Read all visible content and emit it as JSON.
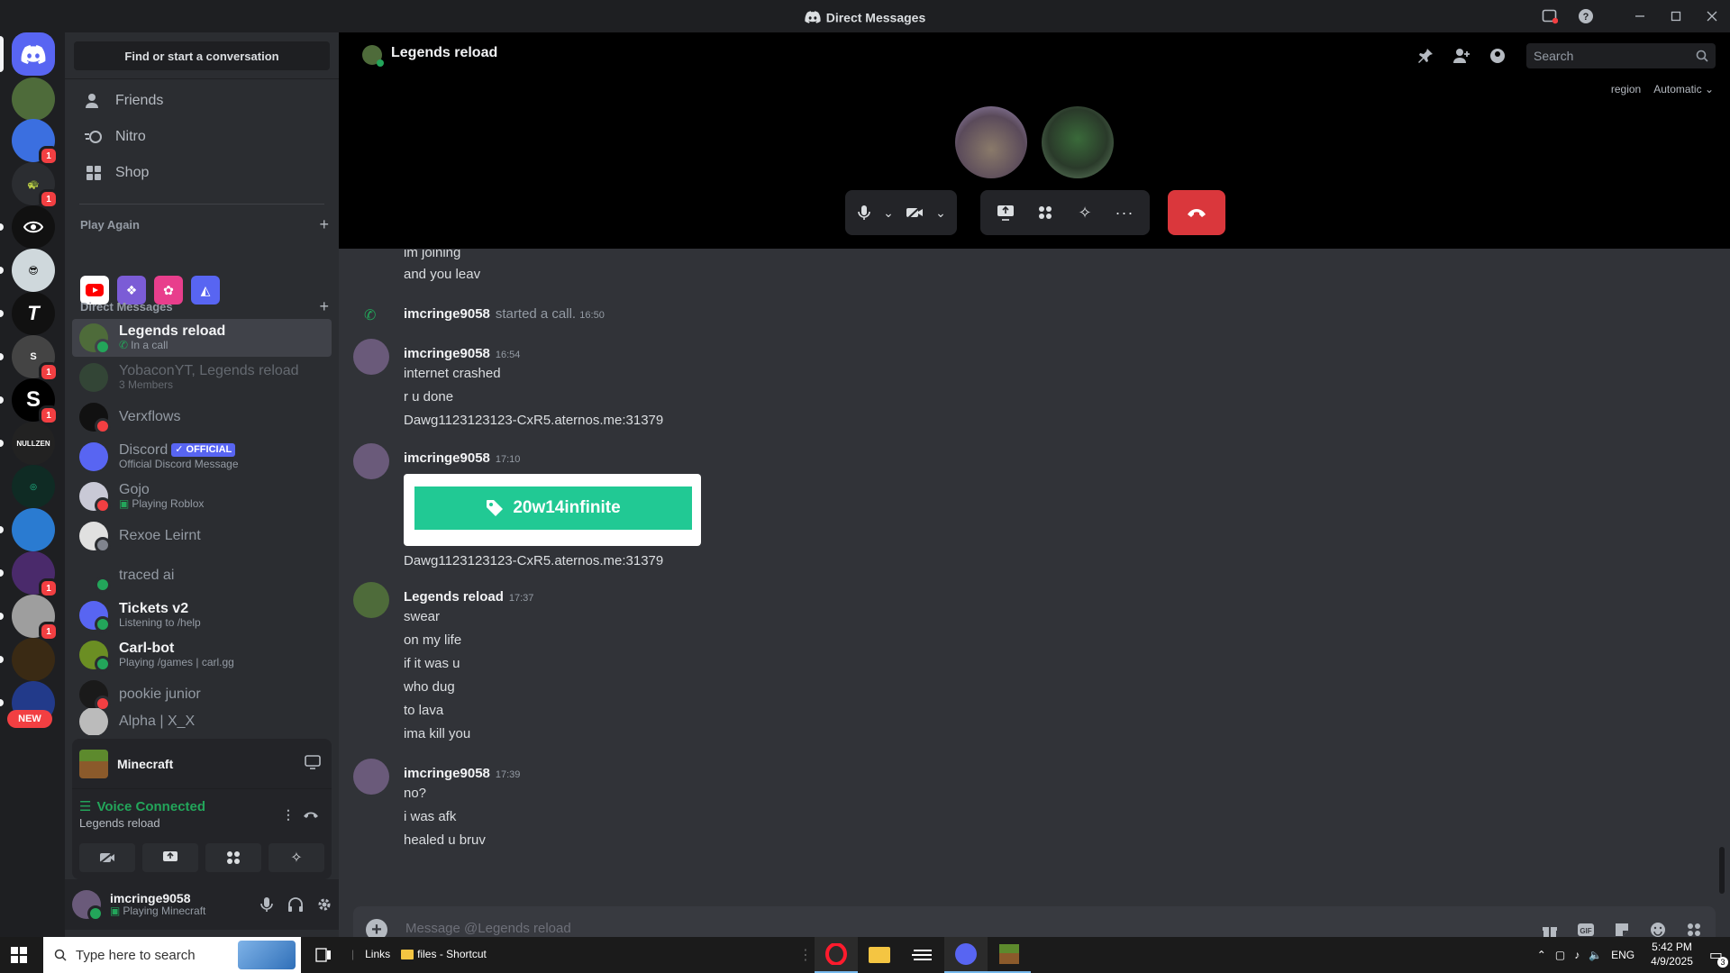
{
  "window": {
    "title": "Direct Messages"
  },
  "rail": {
    "new_label": "NEW",
    "badges": [
      "1",
      "1",
      "1",
      "1",
      "1",
      "1"
    ]
  },
  "sidebar": {
    "find_label": "Find or start a conversation",
    "nav": [
      {
        "label": "Friends",
        "icon": "friends-icon"
      },
      {
        "label": "Nitro",
        "icon": "nitro-icon"
      },
      {
        "label": "Shop",
        "icon": "shop-icon"
      }
    ],
    "play_again": "Play Again",
    "dm_header": "Direct Messages",
    "dms": [
      {
        "name": "Legends reload",
        "sub": "In a call",
        "status": "online",
        "active": true
      },
      {
        "name": "YobaconYT, Legends reload",
        "sub": "3 Members"
      },
      {
        "name": "Verxflows",
        "sub": "",
        "status": "dnd"
      },
      {
        "name": "Discord",
        "badge": "OFFICIAL",
        "sub": "Official Discord Message"
      },
      {
        "name": "Gojo",
        "sub": "Playing Roblox",
        "status": "dnd"
      },
      {
        "name": "Rexoe Leirnt",
        "sub": "",
        "status": "offline"
      },
      {
        "name": "traced ai",
        "sub": "",
        "status": "online"
      },
      {
        "name": "Tickets v2",
        "sub": "Listening to /help",
        "status": "online"
      },
      {
        "name": "Carl-bot",
        "sub": "Playing /games | carl.gg",
        "status": "online"
      },
      {
        "name": "pookie junior",
        "sub": "",
        "status": "dnd"
      },
      {
        "name": "Alpha | X_X",
        "sub": ""
      }
    ]
  },
  "activity": {
    "game": "Minecraft"
  },
  "voice": {
    "status": "Voice Connected",
    "channel": "Legends reload"
  },
  "user": {
    "name": "imcringe9058",
    "status": "Playing Minecraft"
  },
  "header": {
    "name": "Legends reload",
    "search_placeholder": "Search",
    "region_label": "region",
    "region_value": "Automatic"
  },
  "chat": {
    "top_lines": [
      "im joining",
      "and you leav"
    ],
    "call_event": {
      "author": "imcringe9058",
      "text": "started a call.",
      "time": "16:50"
    },
    "messages": [
      {
        "author": "imcringe9058",
        "time": "16:54",
        "lines": [
          "internet crashed",
          "r u done",
          "Dawg1123123123-CxR5.aternos.me:31379"
        ]
      },
      {
        "author": "imcringe9058",
        "time": "17:10",
        "embed_button": "20w14infinite",
        "lines": [
          "Dawg1123123123-CxR5.aternos.me:31379"
        ]
      },
      {
        "author": "Legends reload",
        "time": "17:37",
        "lines": [
          "swear",
          "on my life",
          "if it was u",
          "who dug",
          "to lava",
          "ima kill you"
        ]
      },
      {
        "author": "imcringe9058",
        "time": "17:39",
        "lines": [
          "no?",
          "i was afk",
          "healed u bruv"
        ]
      }
    ]
  },
  "composer": {
    "placeholder": "Message @Legends reload"
  },
  "taskbar": {
    "search_placeholder": "Type here to search",
    "links": "Links",
    "shortcut": "files - Shortcut",
    "lang": "ENG",
    "time": "5:42 PM",
    "date": "4/9/2025",
    "notif": "3"
  },
  "colors": {
    "accent": "#5865f2",
    "green": "#23a55a",
    "red": "#da373c",
    "dnd": "#f23f42",
    "embed_green": "#21c994"
  }
}
